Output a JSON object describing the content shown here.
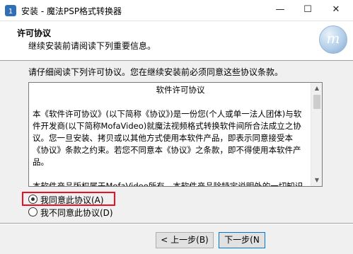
{
  "window": {
    "title": "安装 - 魔法PSP格式转换器",
    "controls": {
      "minimize": "—",
      "maximize": "☐",
      "close": "✕"
    }
  },
  "header": {
    "title": "许可协议",
    "subtitle": "继续安装前请阅读下列重要信息。",
    "logo_letter": "m"
  },
  "main": {
    "instruction": "请仔细阅读下列许可协议。您在继续安装前必须同意这些协议条款。",
    "license": {
      "heading": "软件许可协议",
      "paragraphs": [
        "本《软件许可协议》(以下简称《协议》)是一份您(个人或单一法人团体)与软件开发商(以下简称MofaVideo)就魔法视频格式转换软件间所合法成立之协议。您一旦安装、拷贝或以其他方式使用本软件产品，即表示同意接受本《协议》条款之约束。若您不同意本《协议》之条款，即不得使用本软件产品。",
        "本软件产品版权属于MofaVideo所有，本软件产品除特定说明外的一切知识"
      ]
    },
    "options": {
      "agree": {
        "label": "我同意此协议(A)",
        "selected": true
      },
      "disagree": {
        "label": "我不同意此协议(D)",
        "selected": false
      }
    }
  },
  "footer": {
    "back_label": "< 上一步(B)",
    "next_label": "下一步(N"
  },
  "colors": {
    "highlight": "#e81123",
    "focus_border": "#0078d7"
  }
}
